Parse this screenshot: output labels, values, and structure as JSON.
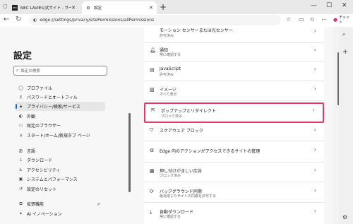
{
  "tabs": [
    {
      "title": "NEC LAVIE公式サイト - サービス＆サ",
      "icon": "NEC"
    },
    {
      "title": "設定",
      "icon": "⚙"
    }
  ],
  "address": {
    "url": "edge://settings/privacy/sitePermissions/allPermissions"
  },
  "copilot_label": "チャット",
  "settings_title": "設定",
  "search_placeholder": "設定の検索",
  "nav_items": [
    "プロファイル",
    "パスワードとオートフィル",
    "プライバシー/検索/サービス",
    "外観",
    "既定のブラウザー",
    "スタート/ホーム/新規タブ ページ",
    "言語",
    "ダウンロード",
    "アクセシビリティ",
    "システムとパフォーマンス",
    "設定のリセット",
    "拡張機能",
    "AI イノベーション"
  ],
  "nav_selected_index": 2,
  "permissions": [
    {
      "title": "モーション センサーまたは光センサー",
      "sub": "許可済み",
      "icon": "motion-sensor-icon"
    },
    {
      "title": "通知",
      "sub": "常に確認する",
      "icon": "bell-icon"
    },
    {
      "title": "JavaScript",
      "sub": "許可済み",
      "icon": "code-icon"
    },
    {
      "title": "イメージ",
      "sub": "すべて表示",
      "icon": "image-icon"
    },
    {
      "title": "ポップアップとリダイレクト",
      "sub": "ブロック済み",
      "icon": "external-link-icon"
    },
    {
      "title": "スケアウェア ブロック",
      "sub": "",
      "icon": "shield-icon"
    },
    {
      "title": "Edge 内のアクションがアクセスできるサイトの管理",
      "sub": "",
      "icon": "gear-icon"
    },
    {
      "title": "押し付けがましい広告",
      "sub": "ブロック済み",
      "icon": "ad-icon"
    },
    {
      "title": "バックグラウンド同期",
      "sub": "最近閉じたサイトの同期を許可する",
      "icon": "sync-icon"
    },
    {
      "title": "自動ダウンロード",
      "sub": "常に確認する",
      "icon": "download-icon"
    }
  ],
  "highlight_color": "#e53a5f"
}
